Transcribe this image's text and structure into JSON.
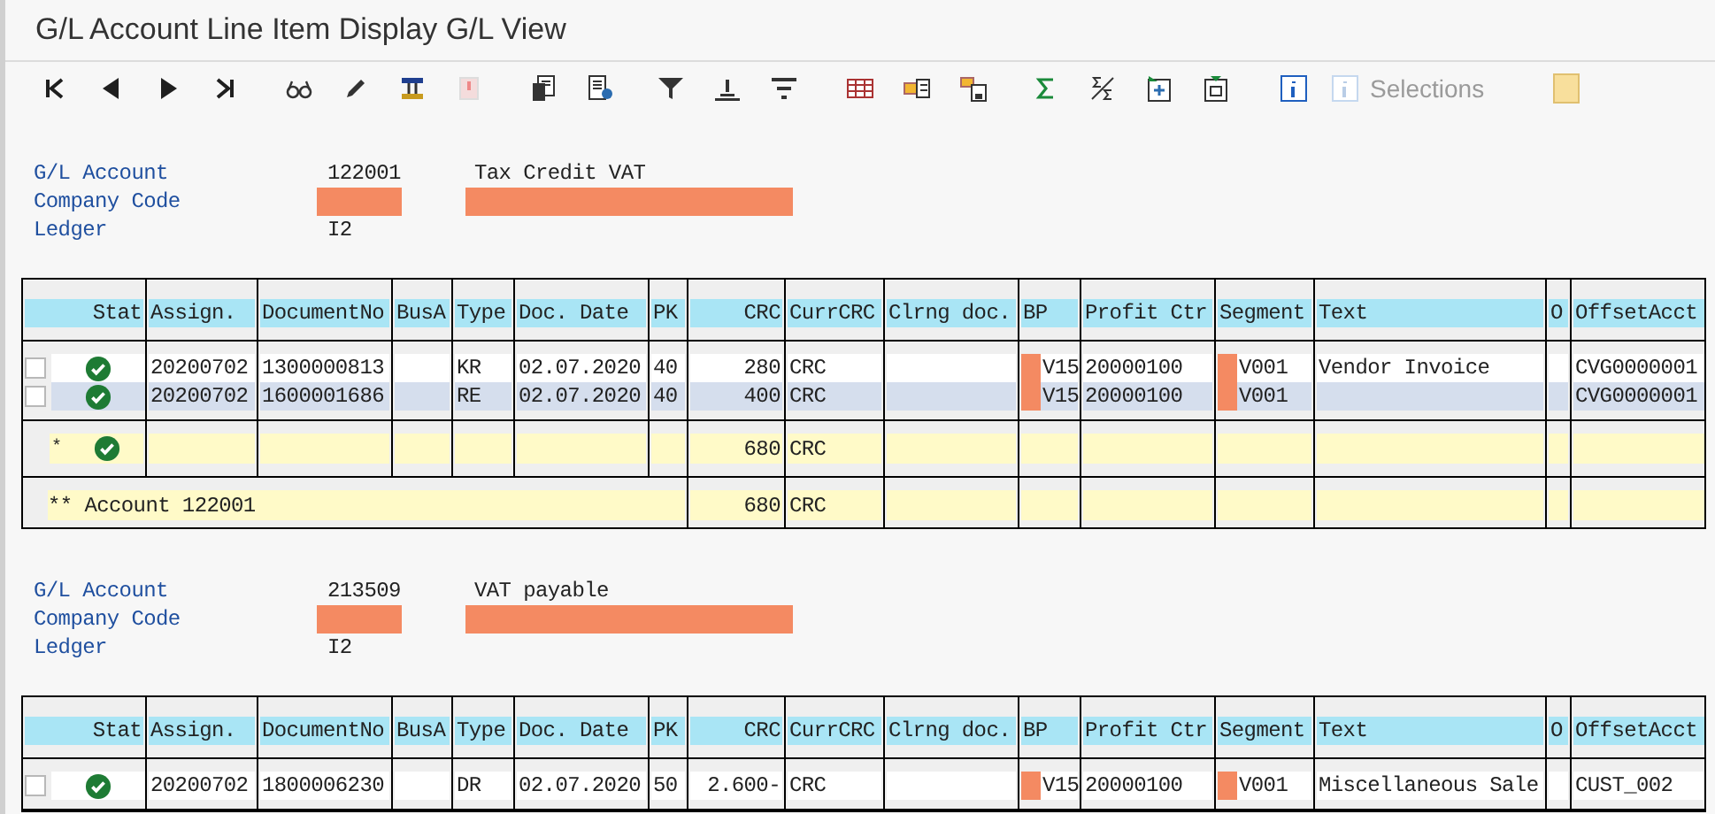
{
  "window": {
    "title": "G/L Account Line Item Display G/L View"
  },
  "toolbar": {
    "selections": {
      "label": "Selections",
      "disabled": true
    }
  },
  "columns": [
    {
      "label": "Stat",
      "kind": "status"
    },
    {
      "label": "Assign.",
      "kind": "text"
    },
    {
      "label": "DocumentNo",
      "kind": "text"
    },
    {
      "label": "BusA",
      "kind": "text"
    },
    {
      "label": "Type",
      "kind": "text"
    },
    {
      "label": "Doc. Date",
      "kind": "text"
    },
    {
      "label": "PK",
      "kind": "text"
    },
    {
      "label": "CRC",
      "kind": "amount"
    },
    {
      "label": "CurrCRC",
      "kind": "currency"
    },
    {
      "label": "Clrng doc.",
      "kind": "text"
    },
    {
      "label": "BP",
      "kind": "redactable"
    },
    {
      "label": "Profit Ctr",
      "kind": "text"
    },
    {
      "label": "Segment",
      "kind": "redactable"
    },
    {
      "label": "Text",
      "kind": "text"
    },
    {
      "label": "O",
      "kind": "text"
    },
    {
      "label": "OffsetAcct",
      "kind": "text"
    }
  ],
  "columns_2": [
    {
      "label": "Stat",
      "kind": "status"
    },
    {
      "label": "Assign.",
      "kind": "text"
    },
    {
      "label": "DocumentNo",
      "kind": "text"
    },
    {
      "label": "BusA",
      "kind": "text"
    },
    {
      "label": "Type",
      "kind": "text"
    },
    {
      "label": "Doc. Date",
      "kind": "text"
    },
    {
      "label": "PK",
      "kind": "text"
    },
    {
      "label": "CRC",
      "kind": "amount"
    },
    {
      "label": "CurrCRC",
      "kind": "currency"
    },
    {
      "label": "Clrng doc.",
      "kind": "text"
    },
    {
      "label": "BP",
      "kind": "redactable"
    },
    {
      "label": "Profit Ctr",
      "kind": "text"
    },
    {
      "label": "Segment",
      "kind": "redactable"
    },
    {
      "label": "Text",
      "kind": "text"
    },
    {
      "label": "O",
      "kind": "text"
    },
    {
      "label": "OffsetAcct",
      "kind": "text"
    }
  ],
  "accounts": [
    {
      "fields": [
        {
          "label": "G/L Account",
          "value": "122001",
          "description": "Tax Credit VAT"
        },
        {
          "label": "Company Code",
          "redacted": true
        },
        {
          "label": "Ledger",
          "value": "I2"
        }
      ],
      "rows": [
        {
          "checked": false,
          "selected": false,
          "ok": true,
          "redacted": true,
          "cells": [
            null,
            "20200702",
            "1300000813",
            null,
            "KR",
            "02.07.2020",
            "40",
            "280",
            "CRC",
            null,
            "V15",
            "20000100",
            "V001",
            "Vendor Invoice",
            null,
            "CVG0000001"
          ]
        },
        {
          "checked": false,
          "selected": true,
          "ok": true,
          "redacted": true,
          "cells": [
            null,
            "20200702",
            "1600001686",
            null,
            "RE",
            "02.07.2020",
            "40",
            "400",
            "CRC",
            null,
            "V15",
            "20000100",
            "V001",
            null,
            null,
            "CVG0000001"
          ]
        }
      ],
      "subtotal": {
        "marker": "*",
        "ok": true,
        "amount": "680",
        "currency": "CRC"
      },
      "total": {
        "label": "** Account 122001",
        "amount": "680",
        "currency": "CRC"
      }
    },
    {
      "fields": [
        {
          "label": "G/L Account",
          "value": "213509",
          "description": "VAT payable"
        },
        {
          "label": "Company Code",
          "redacted": true
        },
        {
          "label": "Ledger",
          "value": "I2"
        }
      ],
      "rows": [
        {
          "checked": false,
          "selected": false,
          "ok": true,
          "redacted": true,
          "cells": [
            null,
            "20200702",
            "1800006230",
            null,
            "DR",
            "02.07.2020",
            "50",
            "2.600-",
            "CRC",
            null,
            "V15",
            "20000100",
            "V001",
            "Miscellaneous Sale",
            null,
            "CUST_002"
          ]
        }
      ]
    }
  ]
}
